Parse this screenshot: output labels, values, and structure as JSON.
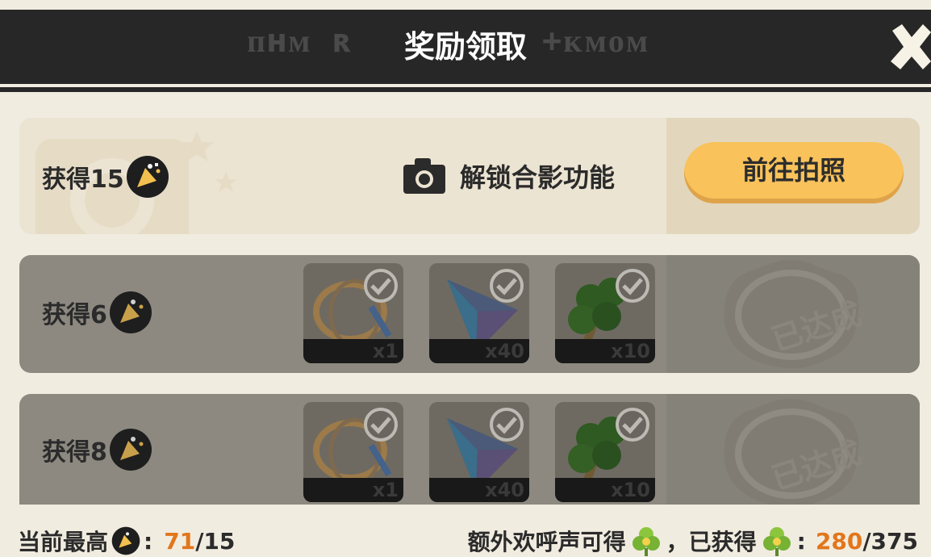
{
  "header": {
    "title": "奖励领取",
    "deco_left": "ᴨʜᴍ ʀ",
    "deco_right": "+ᴋᴍᴏᴍ"
  },
  "rows": [
    {
      "label": "获得15",
      "unlock_text": "解锁合影功能",
      "button_label": "前往拍照",
      "state": "active"
    },
    {
      "label": "获得6",
      "items": [
        {
          "icon": "ring-icon",
          "qty": "x1"
        },
        {
          "icon": "gem-icon",
          "qty": "x40"
        },
        {
          "icon": "tree-icon",
          "qty": "x10"
        }
      ],
      "stamp": "已达成",
      "state": "achieved"
    },
    {
      "label": "获得8",
      "items": [
        {
          "icon": "ring-icon",
          "qty": "x1"
        },
        {
          "icon": "gem-icon",
          "qty": "x40"
        },
        {
          "icon": "tree-icon",
          "qty": "x10"
        }
      ],
      "stamp": "已达成",
      "state": "achieved"
    }
  ],
  "footer": {
    "left_label": "当前最高",
    "left_colon": ":",
    "left_current": "71",
    "left_total": "/15",
    "right_label": "额外欢呼声可得",
    "right_sep": "，已获得",
    "right_colon": ":",
    "right_current": "280",
    "right_total": "/375"
  },
  "colors": {
    "header_bg": "#272727",
    "button": "#f9c25a",
    "accent_number": "#e2761b",
    "achieved_row": "#8d8980"
  }
}
